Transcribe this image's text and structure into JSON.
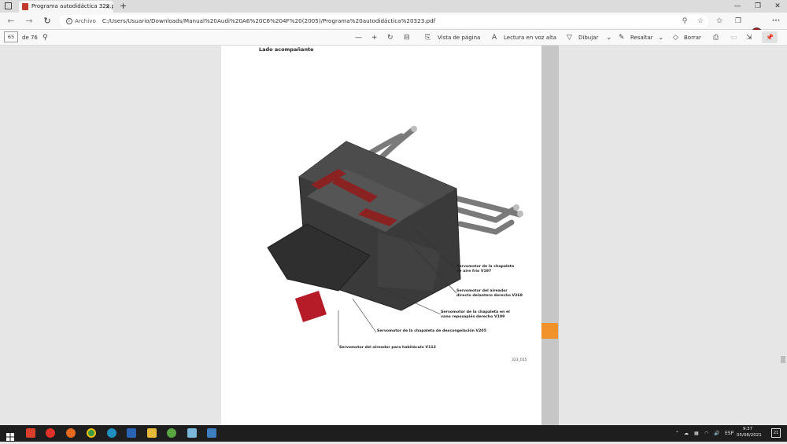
{
  "browser": {
    "tab_title": "Programa autodidáctica 323.pdf",
    "tab_close": "×",
    "new_tab": "+",
    "window_minimize": "—",
    "window_restore": "❐",
    "window_close": "✕",
    "url_label": "Archivo",
    "url": "C:/Users/Usuario/Downloads/Manual%20Audi%20A6%20C6%204F%20(2005)/Programa%20autodidáctica%20323.pdf"
  },
  "pdf_toolbar": {
    "page_current": "65",
    "page_total": "de 76",
    "zoom_out": "—",
    "zoom_in": "+",
    "page_view": "Vista de página",
    "read_aloud": "Lectura en voz alta",
    "draw": "Dibujar",
    "highlight": "Resaltar",
    "erase": "Borrar"
  },
  "document": {
    "heading": "Lado acompañante",
    "labels": [
      "Servomotor de la chapaleta\nde aire frío V197",
      "Servomotor del aireador\ndirecto delantero derecho V268",
      "Servomotor de la chapaleta en el\nvano reposapiés derecho V109",
      "Servomotor de la chapaleta de descongelación V205",
      "Servomotor del aireador para habitáculo V112"
    ],
    "figure_number": "323_015"
  },
  "taskbar": {
    "language": "ESP",
    "time": "9:37",
    "date": "05/08/2021",
    "notifications": "21"
  },
  "colors": {
    "accent_orange": "#f0912a",
    "taskbar": "#1e1e1e",
    "pdf_badge": "#c0392b"
  }
}
